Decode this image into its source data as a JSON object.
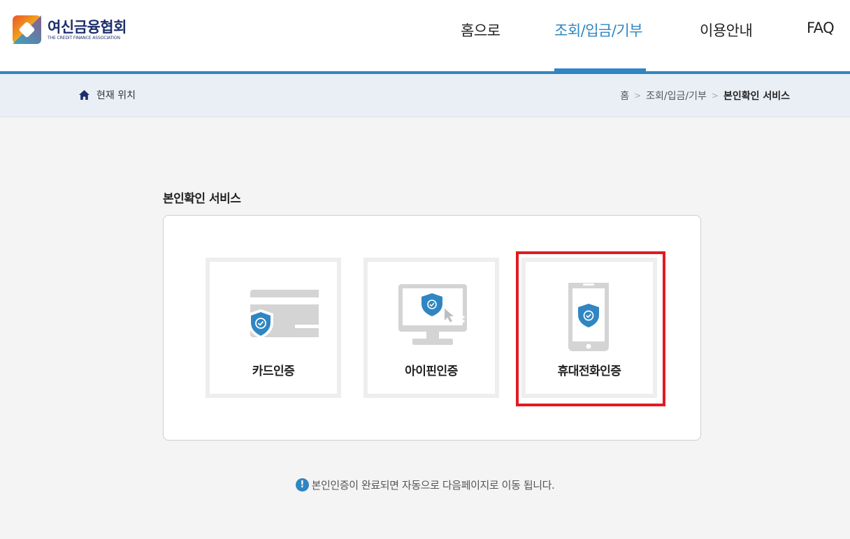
{
  "header": {
    "logo_name": "여신금융협회",
    "logo_sub": "THE CREDIT FINANCE ASSOCIATION",
    "nav": [
      {
        "label": "홈으로"
      },
      {
        "label": "조회/입금/기부"
      },
      {
        "label": "이용안내"
      },
      {
        "label": "FAQ"
      }
    ],
    "active_nav": "조회/입금/기부",
    "accent_color": "#2f86c2"
  },
  "breadcrumb": {
    "location_label": "현재 위치",
    "path": [
      "홈",
      "조회/입금/기부",
      "본인확인 서비스"
    ],
    "separator": ">"
  },
  "main": {
    "title": "본인확인 서비스",
    "options": [
      {
        "label": "카드인증",
        "icon": "card-shield-icon"
      },
      {
        "label": "아이핀인증",
        "icon": "monitor-shield-icon"
      },
      {
        "label": "휴대전화인증",
        "icon": "phone-shield-icon"
      }
    ],
    "highlight_color": "#e21a22"
  },
  "notice": {
    "icon": "!",
    "text": "본인인증이 완료되면 자동으로 다음페이지로 이동 됩니다."
  }
}
